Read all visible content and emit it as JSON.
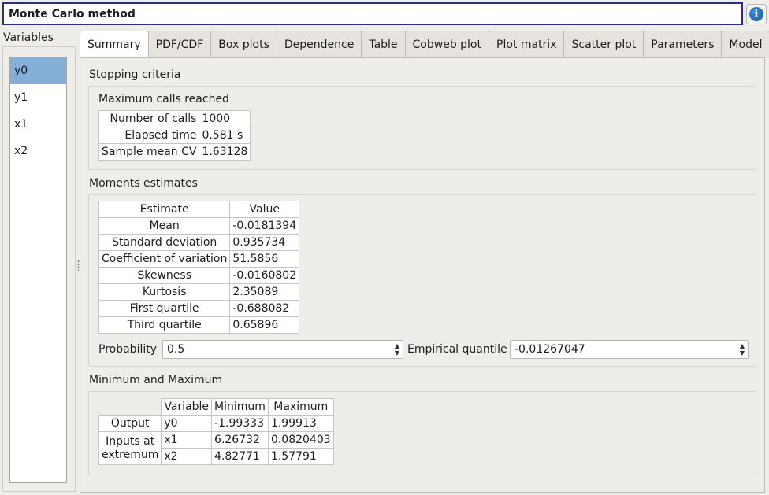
{
  "header": {
    "title": "Monte Carlo method",
    "info_icon": "info-icon"
  },
  "variables": {
    "label": "Variables",
    "items": [
      "y0",
      "y1",
      "x1",
      "x2"
    ],
    "selected": "y0"
  },
  "tabs": [
    "Summary",
    "PDF/CDF",
    "Box plots",
    "Dependence",
    "Table",
    "Cobweb plot",
    "Plot matrix",
    "Scatter plot",
    "Parameters",
    "Model"
  ],
  "active_tab": "Summary",
  "stopping": {
    "title": "Stopping criteria",
    "subtitle": "Maximum calls reached",
    "rows": [
      {
        "label": "Number of calls",
        "value": "1000"
      },
      {
        "label": "Elapsed time",
        "value": "0.581 s"
      },
      {
        "label": "Sample mean CV",
        "value": "1.63128"
      }
    ]
  },
  "moments": {
    "title": "Moments estimates",
    "headers": [
      "Estimate",
      "Value"
    ],
    "rows": [
      {
        "label": "Mean",
        "value": "-0.0181394"
      },
      {
        "label": "Standard deviation",
        "value": "0.935734"
      },
      {
        "label": "Coefficient of variation",
        "value": "51.5856"
      },
      {
        "label": "Skewness",
        "value": "-0.0160802"
      },
      {
        "label": "Kurtosis",
        "value": "2.35089"
      },
      {
        "label": "First quartile",
        "value": "-0.688082"
      },
      {
        "label": "Third quartile",
        "value": "0.65896"
      }
    ],
    "probability_label": "Probability",
    "probability_value": "0.5",
    "quantile_label": "Empirical quantile",
    "quantile_value": "-0.01267047"
  },
  "minmax": {
    "title": "Minimum and Maximum",
    "headers": [
      "Variable",
      "Minimum",
      "Maximum"
    ],
    "output_label": "Output",
    "inputs_label_1": "Inputs at",
    "inputs_label_2": "extremum",
    "rows": [
      {
        "variable": "y0",
        "min": "-1.99333",
        "max": "1.99913"
      },
      {
        "variable": "x1",
        "min": "6.26732",
        "max": "0.0820403"
      },
      {
        "variable": "x2",
        "min": "4.82771",
        "max": "1.57791"
      }
    ]
  }
}
